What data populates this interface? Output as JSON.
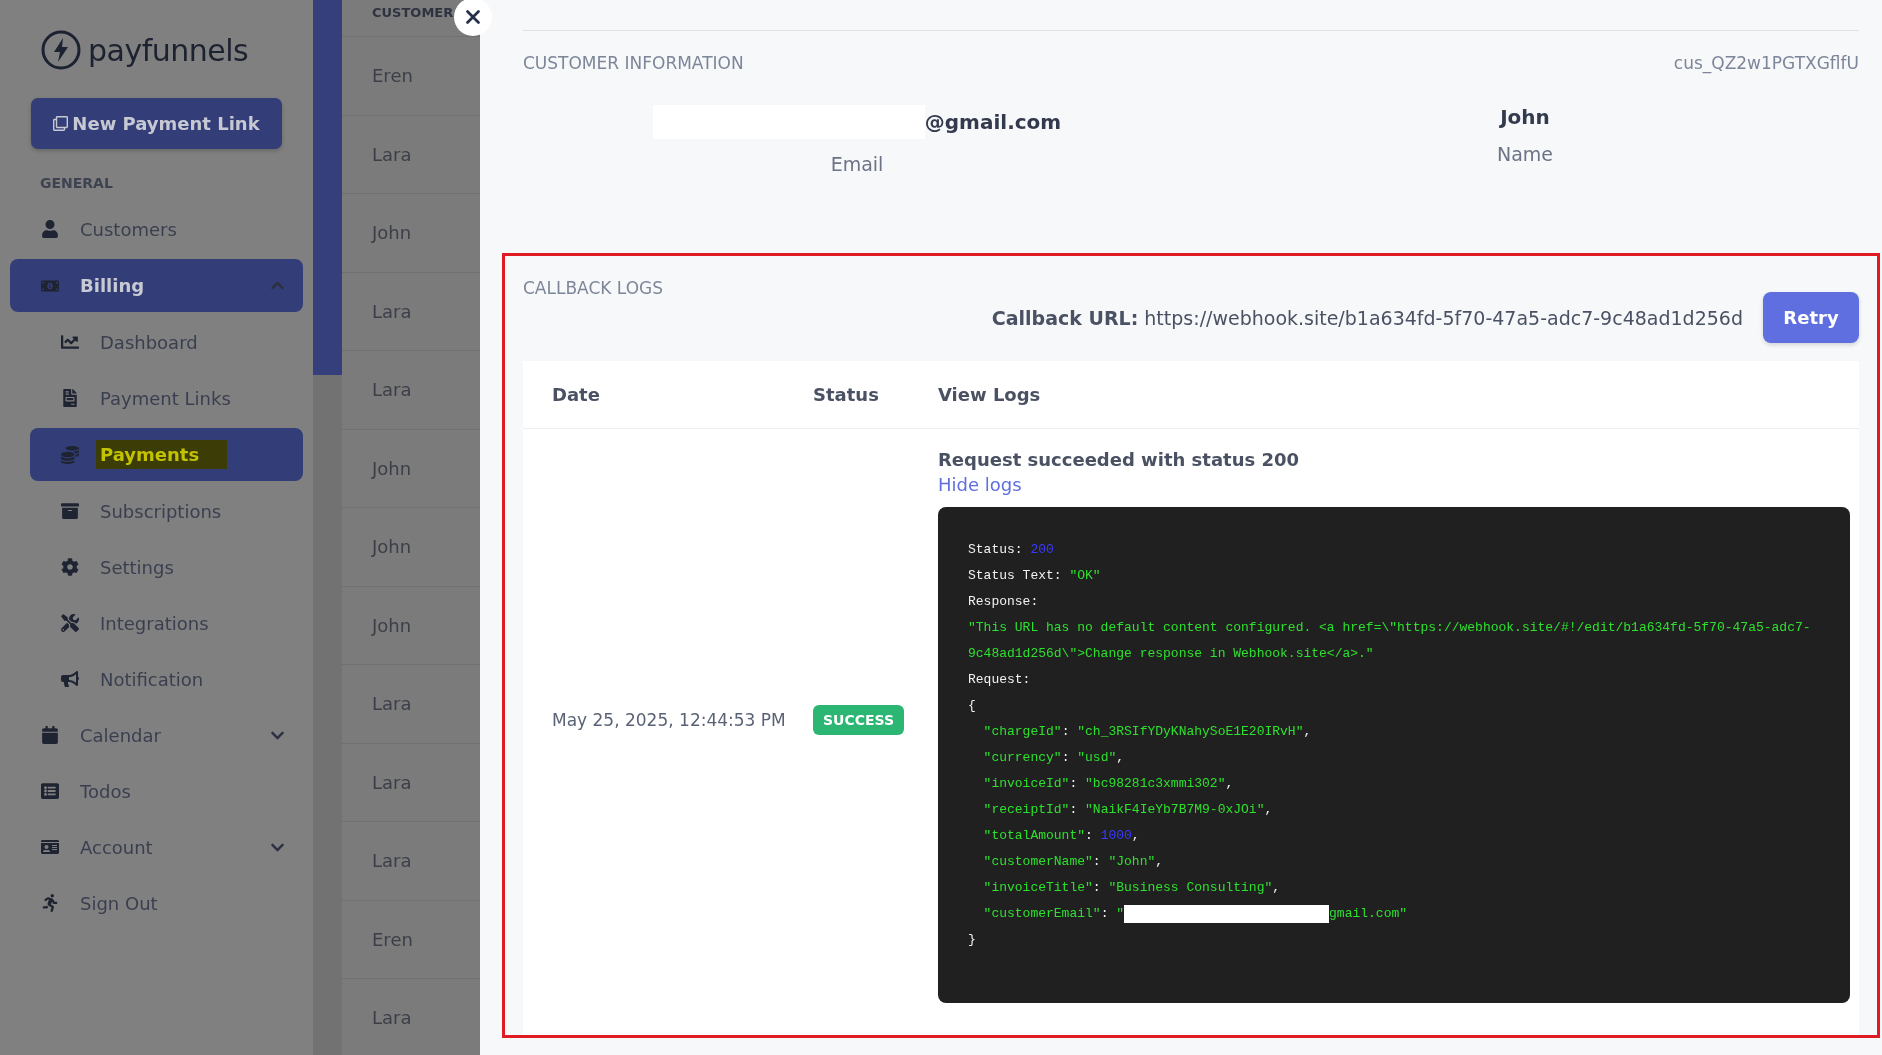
{
  "brand": "payfunnels",
  "new_link_button": "New Payment Link",
  "sidebar": {
    "section": "GENERAL",
    "items": [
      {
        "label": "Customers",
        "selected": false
      },
      {
        "label": "Billing",
        "selected": true,
        "expanded": true,
        "children": [
          {
            "label": "Dashboard",
            "selected": false,
            "highlighted": false
          },
          {
            "label": "Payment Links",
            "selected": false,
            "highlighted": false
          },
          {
            "label": "Payments",
            "selected": true,
            "highlighted": true
          },
          {
            "label": "Subscriptions",
            "selected": false,
            "highlighted": false
          },
          {
            "label": "Settings",
            "selected": false,
            "highlighted": false
          },
          {
            "label": "Integrations",
            "selected": false,
            "highlighted": false
          },
          {
            "label": "Notification",
            "selected": false,
            "highlighted": false
          }
        ]
      },
      {
        "label": "Calendar",
        "selected": false,
        "expanded": false
      },
      {
        "label": "Todos",
        "selected": false
      },
      {
        "label": "Account",
        "selected": false,
        "expanded": false
      },
      {
        "label": "Sign Out",
        "selected": false
      }
    ]
  },
  "customer_table": {
    "header": "CUSTOMER",
    "rows": [
      "Eren",
      "Lara",
      "John",
      "Lara",
      "Lara",
      "John",
      "John",
      "John",
      "Lara",
      "Lara",
      "Lara",
      "Eren",
      "Lara"
    ]
  },
  "customer_information": {
    "title": "CUSTOMER INFORMATION",
    "id": "cus_QZ2w1PGTXGflfU",
    "fields": [
      {
        "value": "@gmail.com",
        "label": "Email",
        "redacted": true
      },
      {
        "value": "John",
        "label": "Name"
      }
    ]
  },
  "callback_logs": {
    "title": "CALLBACK LOGS",
    "highlighted": true,
    "url_label": "Callback URL:",
    "url": "https://webhook.site/b1a634fd-5f70-47a5-adc7-9c48ad1d256d",
    "retry_button": "Retry",
    "columns": [
      "Date",
      "Status",
      "View Logs"
    ],
    "rows": [
      {
        "date": "May 25, 2025, 12:44:53 PM",
        "status": "SUCCESS",
        "message": "Request succeeded with status 200",
        "toggle_link": "Hide logs",
        "log_lines": [
          [
            {
              "text": "Status: ",
              "kind": "plain"
            },
            {
              "text": "200",
              "kind": "number"
            }
          ],
          [
            {
              "text": "Status Text: ",
              "kind": "plain"
            },
            {
              "text": "\"OK\"",
              "kind": "string"
            }
          ],
          [
            {
              "text": "Response:",
              "kind": "plain"
            }
          ],
          [
            {
              "text": "\"This URL has no default content configured. <a href=\\\"https://webhook.site/#!/edit/b1a634fd-5f70-47a5-adc7-9c48ad1d256d\\\">Change response in Webhook.site</a>.\"",
              "kind": "string"
            }
          ],
          [
            {
              "text": "Request:",
              "kind": "plain"
            }
          ],
          [
            {
              "text": "{",
              "kind": "plain"
            }
          ],
          [
            {
              "text": "  \"chargeId\"",
              "kind": "string"
            },
            {
              "text": ": ",
              "kind": "plain"
            },
            {
              "text": "\"ch_3RSIfYDyKNahySoE1E20IRvH\"",
              "kind": "string"
            },
            {
              "text": ",",
              "kind": "plain"
            }
          ],
          [
            {
              "text": "  \"currency\"",
              "kind": "string"
            },
            {
              "text": ": ",
              "kind": "plain"
            },
            {
              "text": "\"usd\"",
              "kind": "string"
            },
            {
              "text": ",",
              "kind": "plain"
            }
          ],
          [
            {
              "text": "  \"invoiceId\"",
              "kind": "string"
            },
            {
              "text": ": ",
              "kind": "plain"
            },
            {
              "text": "\"bc98281c3xmmi302\"",
              "kind": "string"
            },
            {
              "text": ",",
              "kind": "plain"
            }
          ],
          [
            {
              "text": "  \"receiptId\"",
              "kind": "string"
            },
            {
              "text": ": ",
              "kind": "plain"
            },
            {
              "text": "\"NaikF4IeYb7B7M9-0xJOi\"",
              "kind": "string"
            },
            {
              "text": ",",
              "kind": "plain"
            }
          ],
          [
            {
              "text": "  \"totalAmount\"",
              "kind": "string"
            },
            {
              "text": ": ",
              "kind": "plain"
            },
            {
              "text": "1000",
              "kind": "number"
            },
            {
              "text": ",",
              "kind": "plain"
            }
          ],
          [
            {
              "text": "  \"customerName\"",
              "kind": "string"
            },
            {
              "text": ": ",
              "kind": "plain"
            },
            {
              "text": "\"John\"",
              "kind": "string"
            },
            {
              "text": ",",
              "kind": "plain"
            }
          ],
          [
            {
              "text": "  \"invoiceTitle\"",
              "kind": "string"
            },
            {
              "text": ": ",
              "kind": "plain"
            },
            {
              "text": "\"Business Consulting\"",
              "kind": "string"
            },
            {
              "text": ",",
              "kind": "plain"
            }
          ],
          [
            {
              "text": "  \"customerEmail\"",
              "kind": "string"
            },
            {
              "text": ": ",
              "kind": "plain"
            },
            {
              "text": "\"",
              "kind": "string"
            },
            {
              "kind": "redacted"
            },
            {
              "text": "gmail.com\"",
              "kind": "string"
            }
          ],
          [
            {
              "text": "}",
              "kind": "plain"
            }
          ]
        ]
      }
    ]
  }
}
